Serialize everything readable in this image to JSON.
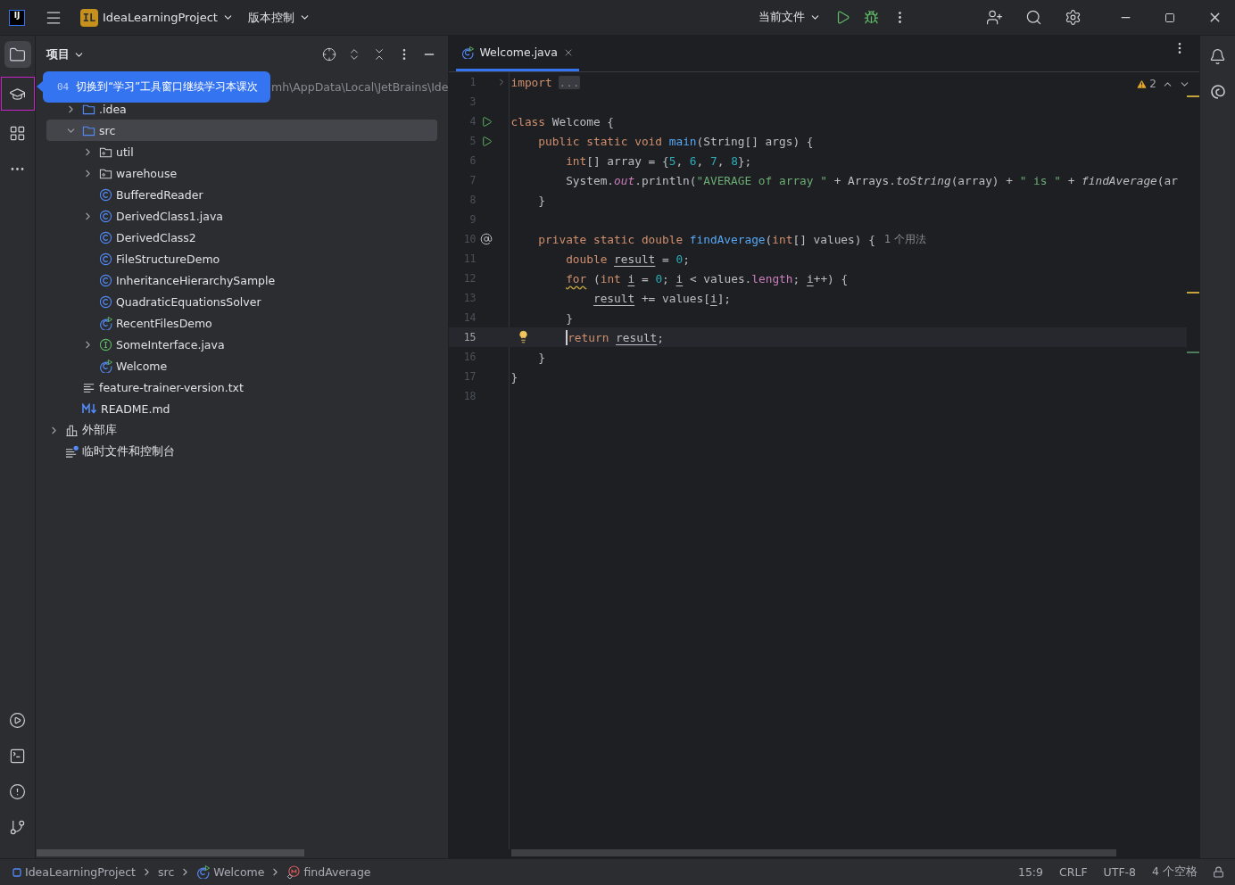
{
  "title_bar": {
    "logo": "IJ",
    "project_badge": "IL",
    "project": "IdeaLearningProject",
    "vcs": "版本控制",
    "run_config": "当前文件"
  },
  "tool_strip_top": [
    {
      "kind": "project",
      "selected": true,
      "highlighted": false
    },
    {
      "kind": "learn",
      "selected": false,
      "highlighted": true
    },
    {
      "kind": "structure",
      "selected": false,
      "highlighted": false
    },
    {
      "kind": "more",
      "selected": false,
      "highlighted": false
    }
  ],
  "tool_strip_bottom": [
    {
      "kind": "services",
      "selected": false,
      "highlighted": false
    },
    {
      "kind": "terminal",
      "selected": false,
      "highlighted": false
    },
    {
      "kind": "problems",
      "selected": false,
      "highlighted": false
    },
    {
      "kind": "git",
      "selected": false,
      "highlighted": false
    }
  ],
  "project_panel": {
    "title": "项目",
    "root_path": "mh\\AppData\\Local\\JetBrains\\Ide",
    "items": [
      {
        "label": ".idea",
        "kind": "folder",
        "expanded": false,
        "selected": false
      },
      {
        "label": "src",
        "kind": "folder",
        "expanded": true,
        "selected": true,
        "children": [
          {
            "label": "util",
            "kind": "package",
            "expanded": false,
            "selected": false
          },
          {
            "label": "warehouse",
            "kind": "package",
            "expanded": false,
            "selected": false
          },
          {
            "label": "BufferedReader",
            "kind": "class",
            "selected": false
          },
          {
            "label": "DerivedClass1.java",
            "kind": "class",
            "expanded": false,
            "selected": false
          },
          {
            "label": "DerivedClass2",
            "kind": "class",
            "selected": false
          },
          {
            "label": "FileStructureDemo",
            "kind": "class",
            "selected": false
          },
          {
            "label": "InheritanceHierarchySample",
            "kind": "class",
            "selected": false
          },
          {
            "label": "QuadraticEquationsSolver",
            "kind": "class",
            "selected": false
          },
          {
            "label": "RecentFilesDemo",
            "kind": "runnable-class",
            "selected": false
          },
          {
            "label": "SomeInterface.java",
            "kind": "interface",
            "expanded": false,
            "selected": false
          },
          {
            "label": "Welcome",
            "kind": "runnable-class",
            "selected": false
          }
        ]
      },
      {
        "label": "feature-trainer-version.txt",
        "kind": "text",
        "selected": false
      },
      {
        "label": "README.md",
        "kind": "markdown",
        "selected": false
      }
    ],
    "top_items": [
      {
        "label": "外部库",
        "kind": "library",
        "expanded": false,
        "selected": false
      },
      {
        "label": "临时文件和控制台",
        "kind": "scratch",
        "selected": false
      }
    ]
  },
  "tooltip": {
    "step": "04",
    "text": "切换到“学习”工具窗口继续学习本课次"
  },
  "editor": {
    "tabs": [
      {
        "label": "Welcome.java",
        "kind": "runnable-class",
        "selected": true
      }
    ],
    "warnings": "2",
    "lines": [
      {
        "number": "1",
        "kind": "plain",
        "current": false,
        "folded": true,
        "tokens": [
          {
            "kind": "kw",
            "text": "import"
          },
          {
            "kind": "fold",
            "text": " ..."
          }
        ]
      },
      {
        "number": "3",
        "kind": "plain",
        "current": false,
        "folded": false
      },
      {
        "number": "4",
        "kind": "run",
        "current": false,
        "folded": false,
        "tokens": [
          {
            "kind": "kw",
            "text": "class"
          },
          {
            "kind": "plain",
            "text": " Welcome {"
          }
        ]
      },
      {
        "number": "5",
        "kind": "run",
        "current": false,
        "folded": false,
        "tokens": [
          {
            "kind": "kw",
            "text": "    public static void"
          },
          {
            "kind": "decl",
            "text": " main"
          },
          {
            "kind": "plain",
            "text": "(String[] args) {"
          }
        ]
      },
      {
        "number": "6",
        "kind": "plain",
        "current": false,
        "folded": false,
        "tokens": [
          {
            "kind": "kw",
            "text": "        int"
          },
          {
            "kind": "plain",
            "text": "[] array = {"
          },
          {
            "kind": "num",
            "text": "5"
          },
          {
            "kind": "plain",
            "text": ", "
          },
          {
            "kind": "num",
            "text": "6"
          },
          {
            "kind": "plain",
            "text": ", "
          },
          {
            "kind": "num",
            "text": "7"
          },
          {
            "kind": "plain",
            "text": ", "
          },
          {
            "kind": "num",
            "text": "8"
          },
          {
            "kind": "plain",
            "text": "};"
          }
        ]
      },
      {
        "number": "7",
        "kind": "plain",
        "current": false,
        "folded": false,
        "tokens": [
          {
            "kind": "plain",
            "text": "        System."
          },
          {
            "kind": "static-field",
            "text": "out"
          },
          {
            "kind": "plain",
            "text": ".println("
          },
          {
            "kind": "str",
            "text": "\"AVERAGE of array \""
          },
          {
            "kind": "plain",
            "text": " + Arrays."
          },
          {
            "kind": "static",
            "text": "toString"
          },
          {
            "kind": "plain",
            "text": "(array) + "
          },
          {
            "kind": "str",
            "text": "\" is \""
          },
          {
            "kind": "plain",
            "text": " + "
          },
          {
            "kind": "static",
            "text": "findAverage"
          },
          {
            "kind": "plain",
            "text": "(ar"
          }
        ]
      },
      {
        "number": "8",
        "kind": "plain",
        "current": false,
        "folded": false,
        "tokens": [
          {
            "kind": "plain",
            "text": "    }"
          }
        ]
      },
      {
        "number": "9",
        "kind": "plain",
        "current": false,
        "folded": false
      },
      {
        "number": "10",
        "kind": "override",
        "current": false,
        "folded": false,
        "tokens": [
          {
            "kind": "kw",
            "text": "    private static double"
          },
          {
            "kind": "decl",
            "text": " findAverage"
          },
          {
            "kind": "plain",
            "text": "("
          },
          {
            "kind": "kw",
            "text": "int"
          },
          {
            "kind": "plain",
            "text": "[] values) {"
          },
          {
            "kind": "hint",
            "text": "1 个用法"
          }
        ]
      },
      {
        "number": "11",
        "kind": "plain",
        "current": false,
        "folded": false,
        "tokens": [
          {
            "kind": "kw",
            "text": "        double "
          },
          {
            "kind": "var",
            "text": "result"
          },
          {
            "kind": "plain",
            "text": " = "
          },
          {
            "kind": "num",
            "text": "0"
          },
          {
            "kind": "plain",
            "text": ";"
          }
        ]
      },
      {
        "number": "12",
        "kind": "plain",
        "current": false,
        "folded": false,
        "tokens": [
          {
            "kind": "kw-warn",
            "text": "        for"
          },
          {
            "kind": "plain",
            "text": " ("
          },
          {
            "kind": "kw",
            "text": "int "
          },
          {
            "kind": "var",
            "text": "i"
          },
          {
            "kind": "plain",
            "text": " = "
          },
          {
            "kind": "num",
            "text": "0"
          },
          {
            "kind": "plain",
            "text": "; "
          },
          {
            "kind": "var",
            "text": "i"
          },
          {
            "kind": "plain",
            "text": " < values."
          },
          {
            "kind": "field",
            "text": "length"
          },
          {
            "kind": "plain",
            "text": "; "
          },
          {
            "kind": "var",
            "text": "i"
          },
          {
            "kind": "plain",
            "text": "++) {"
          }
        ]
      },
      {
        "number": "13",
        "kind": "plain",
        "current": false,
        "folded": false,
        "tokens": [
          {
            "kind": "var",
            "text": "            result"
          },
          {
            "kind": "plain",
            "text": " += values["
          },
          {
            "kind": "var",
            "text": "i"
          },
          {
            "kind": "plain",
            "text": "];"
          }
        ]
      },
      {
        "number": "14",
        "kind": "plain",
        "current": false,
        "folded": false,
        "tokens": [
          {
            "kind": "plain",
            "text": "        }"
          }
        ]
      },
      {
        "number": "15",
        "kind": "plain",
        "current": true,
        "folded": false,
        "intention": true,
        "tokens": [
          {
            "kind": "kw",
            "text": "        return "
          },
          {
            "kind": "var",
            "text": "result"
          },
          {
            "kind": "plain",
            "text": ";"
          }
        ]
      },
      {
        "number": "16",
        "kind": "plain",
        "current": false,
        "folded": false,
        "tokens": [
          {
            "kind": "plain",
            "text": "    }"
          }
        ]
      },
      {
        "number": "17",
        "kind": "plain",
        "current": false,
        "folded": false,
        "tokens": [
          {
            "kind": "plain",
            "text": "}"
          }
        ]
      },
      {
        "number": "18",
        "kind": "plain",
        "current": false,
        "folded": false
      }
    ]
  },
  "right_strip": [
    {
      "kind": "notifications"
    },
    {
      "kind": "ai"
    }
  ],
  "status_bar": {
    "breadcrumbs": [
      {
        "label": "IdeaLearningProject",
        "kind": "module"
      },
      {
        "label": "src",
        "kind": "plain"
      },
      {
        "label": "Welcome",
        "kind": "runnable-class"
      },
      {
        "label": "findAverage",
        "kind": "method"
      }
    ],
    "items": [
      "15:9",
      "CRLF",
      "UTF-8",
      "4 个空格"
    ]
  }
}
